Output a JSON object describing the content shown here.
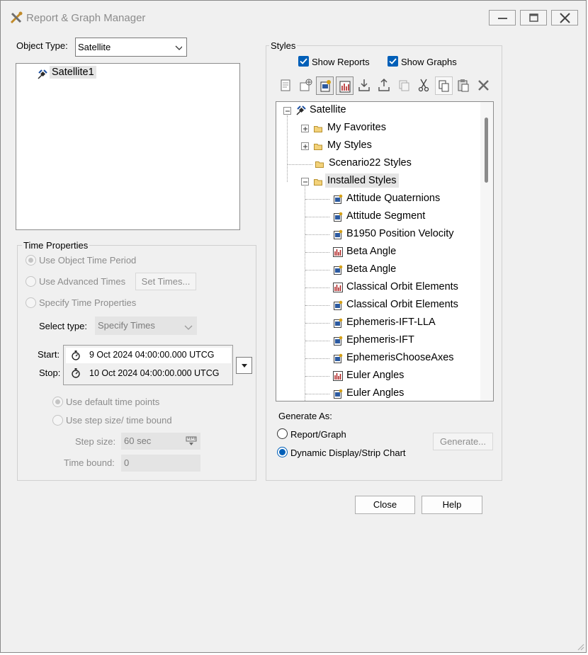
{
  "window": {
    "title": "Report & Graph Manager"
  },
  "object_type": {
    "label": "Object Type:",
    "value": "Satellite"
  },
  "objects": [
    {
      "name": "Satellite1"
    }
  ],
  "time_properties": {
    "title": "Time Properties",
    "use_object_time": "Use Object Time Period",
    "use_advanced_times": "Use Advanced Times",
    "set_times_button": "Set Times...",
    "specify_time_properties": "Specify Time Properties",
    "select_type_label": "Select type:",
    "select_type_value": "Specify Times",
    "start_label": "Start:",
    "start_value": "9 Oct 2024 04:00:00.000 UTCG",
    "stop_label": "Stop:",
    "stop_value": "10 Oct 2024 04:00:00.000 UTCG",
    "use_default_time_points": "Use default time points",
    "use_step_size": "Use step size/ time bound",
    "step_size_label": "Step size:",
    "step_size_value": "60 sec",
    "time_bound_label": "Time bound:",
    "time_bound_value": "0"
  },
  "styles": {
    "title": "Styles",
    "show_reports": "Show Reports",
    "show_graphs": "Show Graphs",
    "show_reports_checked": true,
    "show_graphs_checked": true,
    "toolbar": [
      "new-report-icon",
      "new-graph-wizard-icon",
      "properties-icon",
      "graph-properties-icon",
      "import-icon",
      "export-icon",
      "duplicate-icon",
      "cut-icon",
      "copy-icon",
      "paste-icon",
      "delete-icon"
    ],
    "tree": {
      "root": "Satellite",
      "folders": [
        "My Favorites",
        "My Styles",
        "Scenario22 Styles",
        "Installed Styles"
      ],
      "installed": [
        {
          "name": "Attitude Quaternions",
          "kind": "report"
        },
        {
          "name": "Attitude Segment",
          "kind": "report"
        },
        {
          "name": "B1950 Position Velocity",
          "kind": "report"
        },
        {
          "name": "Beta Angle",
          "kind": "graph"
        },
        {
          "name": "Beta Angle",
          "kind": "report"
        },
        {
          "name": "Classical Orbit Elements",
          "kind": "graph"
        },
        {
          "name": "Classical Orbit Elements",
          "kind": "report"
        },
        {
          "name": "Ephemeris-IFT-LLA",
          "kind": "report"
        },
        {
          "name": "Ephemeris-IFT",
          "kind": "report"
        },
        {
          "name": "EphemerisChooseAxes",
          "kind": "report"
        },
        {
          "name": "Euler Angles",
          "kind": "graph"
        },
        {
          "name": "Euler Angles",
          "kind": "report"
        }
      ]
    }
  },
  "generate": {
    "title": "Generate As:",
    "report_graph": "Report/Graph",
    "dynamic_display": "Dynamic Display/Strip Chart",
    "selected": "dynamic",
    "generate_button": "Generate..."
  },
  "buttons": {
    "close": "Close",
    "help": "Help"
  },
  "colors": {
    "accent": "#005fb8",
    "disabled_text": "#8c8c8c",
    "selection": "#e5e5e5"
  }
}
